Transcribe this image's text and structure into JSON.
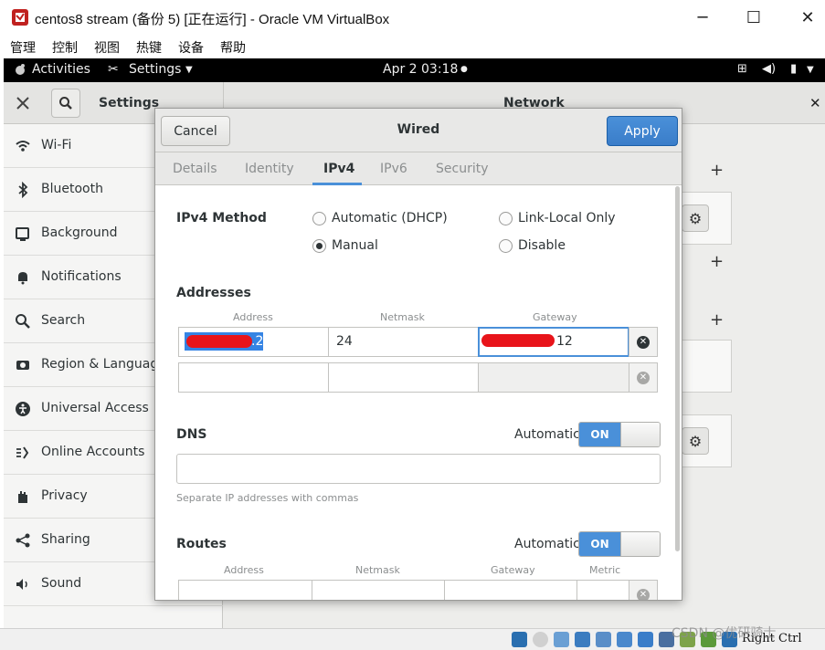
{
  "window": {
    "title": "centos8 stream (备份 5) [正在运行] - Oracle VM VirtualBox",
    "controls": {
      "minimize": "─",
      "maximize": "☐",
      "close": "✕"
    }
  },
  "vbox_menu": [
    "管理",
    "控制",
    "视图",
    "热键",
    "设备",
    "帮助"
  ],
  "gnome_bar": {
    "activities": "Activities",
    "settings_menu": "Settings",
    "clock": "Apr 2  03:18"
  },
  "settings": {
    "header_title": "Settings",
    "panel_title": "Network",
    "sidebar": [
      {
        "label": "Wi-Fi",
        "icon": "wifi-icon"
      },
      {
        "label": "Bluetooth",
        "icon": "bluetooth-icon"
      },
      {
        "label": "Background",
        "icon": "background-icon"
      },
      {
        "label": "Notifications",
        "icon": "bell-icon"
      },
      {
        "label": "Search",
        "icon": "search-icon"
      },
      {
        "label": "Region & Language",
        "icon": "camera-icon"
      },
      {
        "label": "Universal Access",
        "icon": "accessibility-icon"
      },
      {
        "label": "Online Accounts",
        "icon": "accounts-icon"
      },
      {
        "label": "Privacy",
        "icon": "hand-icon"
      },
      {
        "label": "Sharing",
        "icon": "share-icon"
      },
      {
        "label": "Sound",
        "icon": "speaker-icon"
      }
    ]
  },
  "dialog": {
    "cancel_label": "Cancel",
    "title": "Wired",
    "apply_label": "Apply",
    "tabs": [
      "Details",
      "Identity",
      "IPv4",
      "IPv6",
      "Security"
    ],
    "active_tab": "IPv4",
    "ipv4_method": {
      "label": "IPv4 Method",
      "options": [
        "Automatic (DHCP)",
        "Link-Local Only",
        "Manual",
        "Disable"
      ],
      "selected": "Manual"
    },
    "addresses": {
      "title": "Addresses",
      "columns": [
        "Address",
        "Netmask",
        "Gateway"
      ],
      "rows": [
        {
          "address": ".2",
          "netmask": "24",
          "gateway": "12"
        },
        {
          "address": "",
          "netmask": "",
          "gateway": ""
        }
      ]
    },
    "dns": {
      "title": "DNS",
      "automatic_label": "Automatic",
      "switch_label": "ON",
      "value": "",
      "hint": "Separate IP addresses with commas"
    },
    "routes": {
      "title": "Routes",
      "automatic_label": "Automatic",
      "switch_label": "ON",
      "columns": [
        "Address",
        "Netmask",
        "Gateway",
        "Metric"
      ]
    }
  },
  "status_bar": {
    "host_key": "Right Ctrl",
    "watermark": "CSDN @优研骑士"
  },
  "colors": {
    "accent": "#4a90d9",
    "redaction": "#e8141a"
  }
}
